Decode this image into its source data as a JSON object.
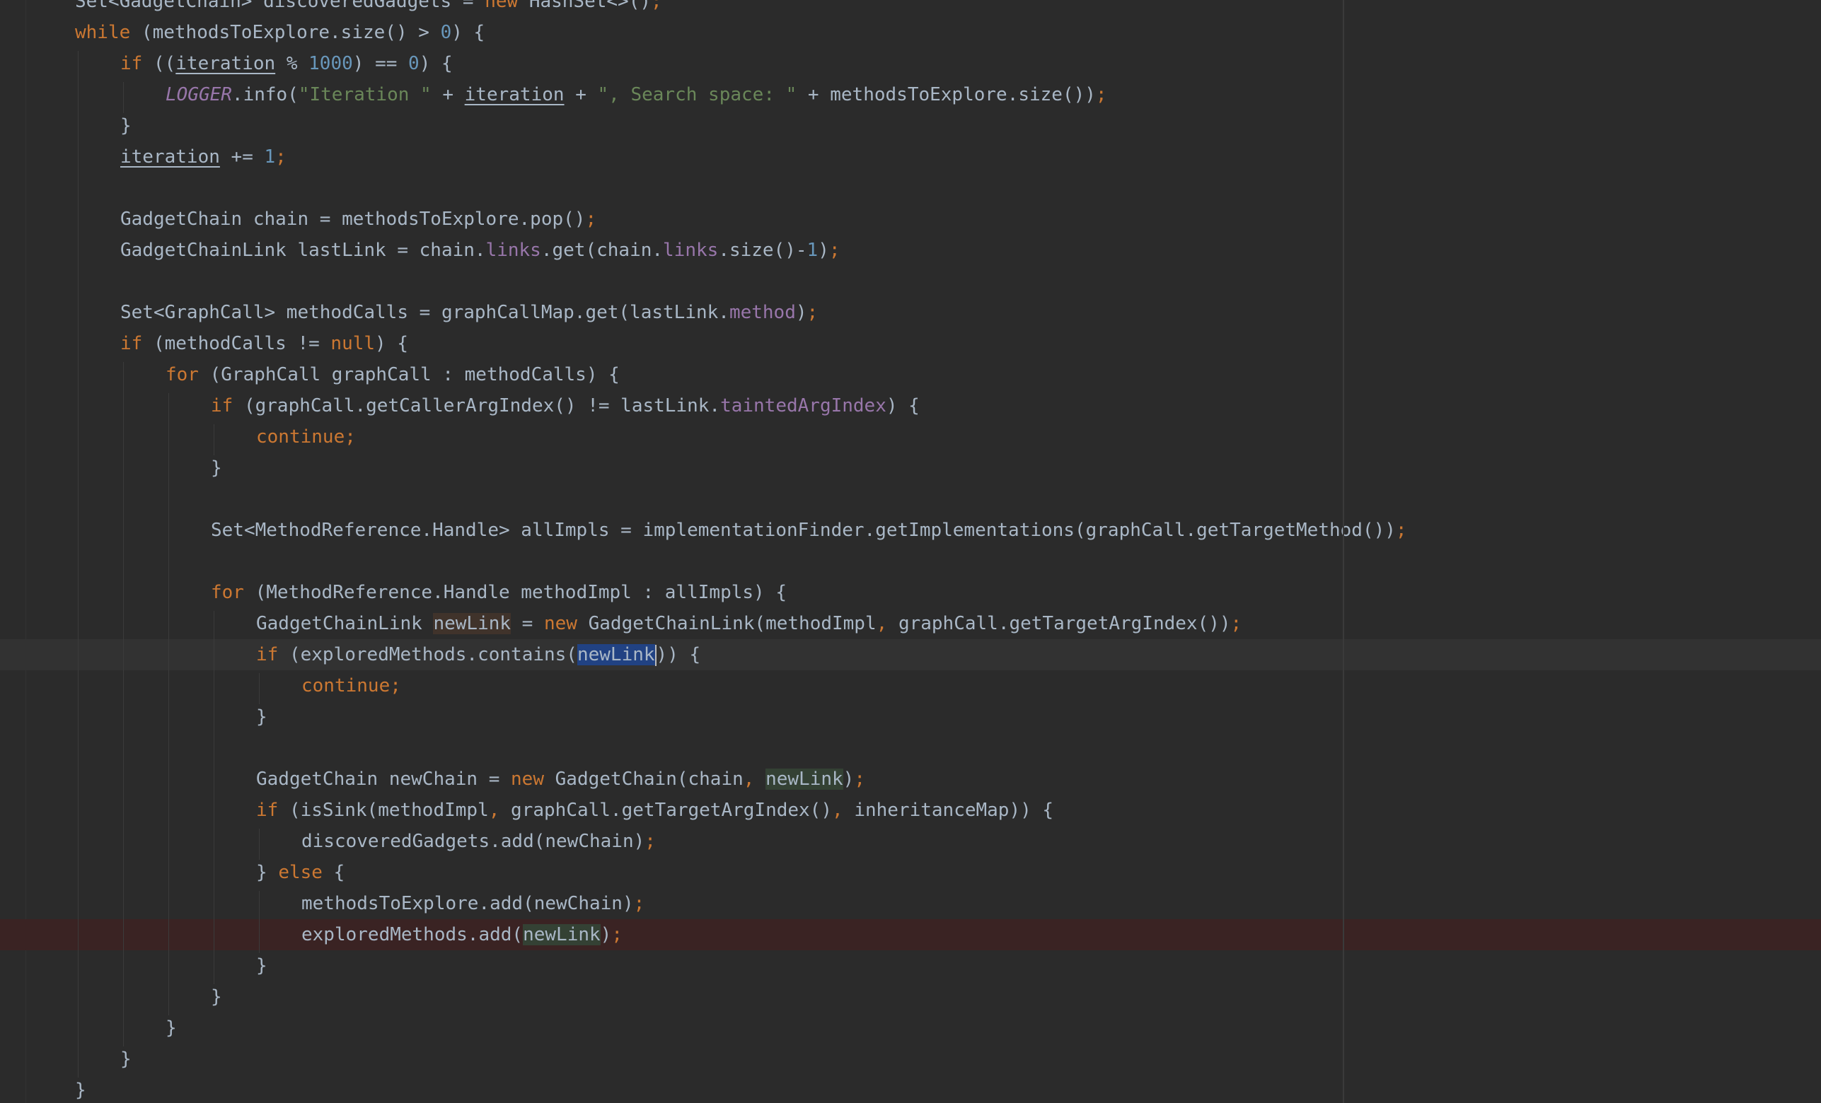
{
  "editor": {
    "language": "java",
    "lines": [
      {
        "indent": 1,
        "tokens": [
          [
            "plain",
            "Set<GadgetChain> discoveredGadgets = "
          ],
          [
            "kw",
            "new "
          ],
          [
            "plain",
            "HashSet<>()"
          ],
          [
            "semi",
            ";"
          ]
        ]
      },
      {
        "indent": 1,
        "tokens": [
          [
            "kw",
            "while "
          ],
          [
            "plain",
            "(methodsToExplore.size() > "
          ],
          [
            "num",
            "0"
          ],
          [
            "plain",
            ") {"
          ]
        ]
      },
      {
        "indent": 2,
        "tokens": [
          [
            "kw",
            "if "
          ],
          [
            "plain",
            "(("
          ],
          [
            "plain_ul",
            "iteration"
          ],
          [
            "plain",
            " % "
          ],
          [
            "num",
            "1000"
          ],
          [
            "plain",
            ") == "
          ],
          [
            "num",
            "0"
          ],
          [
            "plain",
            ") {"
          ]
        ]
      },
      {
        "indent": 3,
        "tokens": [
          [
            "static",
            "LOGGER"
          ],
          [
            "plain",
            ".info("
          ],
          [
            "str",
            "\"Iteration \""
          ],
          [
            "plain",
            " + "
          ],
          [
            "plain_ul",
            "iteration"
          ],
          [
            "plain",
            " + "
          ],
          [
            "str",
            "\", Search space: \""
          ],
          [
            "plain",
            " + methodsToExplore.size())"
          ],
          [
            "semi",
            ";"
          ]
        ]
      },
      {
        "indent": 2,
        "tokens": [
          [
            "plain",
            "}"
          ]
        ]
      },
      {
        "indent": 2,
        "tokens": [
          [
            "plain_ul",
            "iteration"
          ],
          [
            "plain",
            " += "
          ],
          [
            "num",
            "1"
          ],
          [
            "semi",
            ";"
          ]
        ]
      },
      {
        "indent": 0,
        "tokens": []
      },
      {
        "indent": 2,
        "tokens": [
          [
            "plain",
            "GadgetChain chain = methodsToExplore.pop()"
          ],
          [
            "semi",
            ";"
          ]
        ]
      },
      {
        "indent": 2,
        "tokens": [
          [
            "plain",
            "GadgetChainLink lastLink = chain."
          ],
          [
            "field",
            "links"
          ],
          [
            "plain",
            ".get(chain."
          ],
          [
            "field",
            "links"
          ],
          [
            "plain",
            ".size()-"
          ],
          [
            "num",
            "1"
          ],
          [
            "plain",
            ")"
          ],
          [
            "semi",
            ";"
          ]
        ]
      },
      {
        "indent": 0,
        "tokens": []
      },
      {
        "indent": 2,
        "tokens": [
          [
            "plain",
            "Set<GraphCall> methodCalls = graphCallMap.get(lastLink."
          ],
          [
            "field",
            "method"
          ],
          [
            "plain",
            ")"
          ],
          [
            "semi",
            ";"
          ]
        ]
      },
      {
        "indent": 2,
        "tokens": [
          [
            "kw",
            "if "
          ],
          [
            "plain",
            "(methodCalls != "
          ],
          [
            "kw",
            "null"
          ],
          [
            "plain",
            ") {"
          ]
        ]
      },
      {
        "indent": 3,
        "tokens": [
          [
            "kw",
            "for "
          ],
          [
            "plain",
            "(GraphCall graphCall : methodCalls) {"
          ]
        ]
      },
      {
        "indent": 4,
        "tokens": [
          [
            "kw",
            "if "
          ],
          [
            "plain",
            "(graphCall.getCallerArgIndex() != lastLink."
          ],
          [
            "field",
            "taintedArgIndex"
          ],
          [
            "plain",
            ") {"
          ]
        ]
      },
      {
        "indent": 5,
        "tokens": [
          [
            "kw",
            "continue"
          ],
          [
            "semi",
            ";"
          ]
        ]
      },
      {
        "indent": 4,
        "tokens": [
          [
            "plain",
            "}"
          ]
        ]
      },
      {
        "indent": 0,
        "tokens": []
      },
      {
        "indent": 4,
        "tokens": [
          [
            "plain",
            "Set<MethodReference.Handle> allImpls = implementationFinder.getImplementations(graphCall.getTargetMethod())"
          ],
          [
            "semi",
            ";"
          ]
        ]
      },
      {
        "indent": 0,
        "tokens": []
      },
      {
        "indent": 4,
        "tokens": [
          [
            "kw",
            "for "
          ],
          [
            "plain",
            "(MethodReference.Handle methodImpl : allImpls) {"
          ]
        ]
      },
      {
        "indent": 5,
        "tokens": [
          [
            "plain",
            "GadgetChainLink "
          ],
          [
            "plain_hlw",
            "newLink"
          ],
          [
            "plain",
            " = "
          ],
          [
            "kw",
            "new "
          ],
          [
            "plain",
            "GadgetChainLink(methodImpl"
          ],
          [
            "semi",
            ", "
          ],
          [
            "plain",
            "graphCall.getTargetArgIndex())"
          ],
          [
            "semi",
            ";"
          ]
        ]
      },
      {
        "indent": 5,
        "current": true,
        "tokens": [
          [
            "kw",
            "if "
          ],
          [
            "plain",
            "(exploredMethods.contains("
          ],
          [
            "plain_sel",
            "newLink"
          ],
          [
            "caret",
            ""
          ],
          [
            "plain",
            ")) {"
          ]
        ]
      },
      {
        "indent": 6,
        "tokens": [
          [
            "kw",
            "continue"
          ],
          [
            "semi",
            ";"
          ]
        ]
      },
      {
        "indent": 5,
        "tokens": [
          [
            "plain",
            "}"
          ]
        ]
      },
      {
        "indent": 0,
        "tokens": []
      },
      {
        "indent": 5,
        "tokens": [
          [
            "plain",
            "GadgetChain newChain = "
          ],
          [
            "kw",
            "new "
          ],
          [
            "plain",
            "GadgetChain(chain"
          ],
          [
            "semi",
            ", "
          ],
          [
            "plain_hlr",
            "newLink"
          ],
          [
            "plain",
            ")"
          ],
          [
            "semi",
            ";"
          ]
        ]
      },
      {
        "indent": 5,
        "tokens": [
          [
            "kw",
            "if "
          ],
          [
            "plain",
            "(isSink(methodImpl"
          ],
          [
            "semi",
            ", "
          ],
          [
            "plain",
            "graphCall.getTargetArgIndex()"
          ],
          [
            "semi",
            ", "
          ],
          [
            "plain",
            "inheritanceMap)) {"
          ]
        ]
      },
      {
        "indent": 6,
        "tokens": [
          [
            "plain",
            "discoveredGadgets.add(newChain)"
          ],
          [
            "semi",
            ";"
          ]
        ]
      },
      {
        "indent": 5,
        "tokens": [
          [
            "plain",
            "} "
          ],
          [
            "kw",
            "else "
          ],
          [
            "plain",
            "{"
          ]
        ]
      },
      {
        "indent": 6,
        "tokens": [
          [
            "plain",
            "methodsToExplore.add(newChain)"
          ],
          [
            "semi",
            ";"
          ]
        ]
      },
      {
        "indent": 6,
        "breakpoint": true,
        "tokens": [
          [
            "plain",
            "exploredMethods.add("
          ],
          [
            "plain_hlr",
            "newLink"
          ],
          [
            "plain",
            ")"
          ],
          [
            "semi",
            ";"
          ]
        ]
      },
      {
        "indent": 5,
        "tokens": [
          [
            "plain",
            "}"
          ]
        ]
      },
      {
        "indent": 4,
        "tokens": [
          [
            "plain",
            "}"
          ]
        ]
      },
      {
        "indent": 3,
        "tokens": [
          [
            "plain",
            "}"
          ]
        ]
      },
      {
        "indent": 2,
        "tokens": [
          [
            "plain",
            "}"
          ]
        ]
      },
      {
        "indent": 1,
        "tokens": [
          [
            "plain",
            "}"
          ]
        ]
      }
    ]
  },
  "colors": {
    "background": "#2b2b2b",
    "keyword": "#cc7832",
    "number": "#6897bb",
    "string": "#6a8759",
    "field": "#9876aa",
    "text": "#a9b7c6",
    "selection": "#214283"
  }
}
